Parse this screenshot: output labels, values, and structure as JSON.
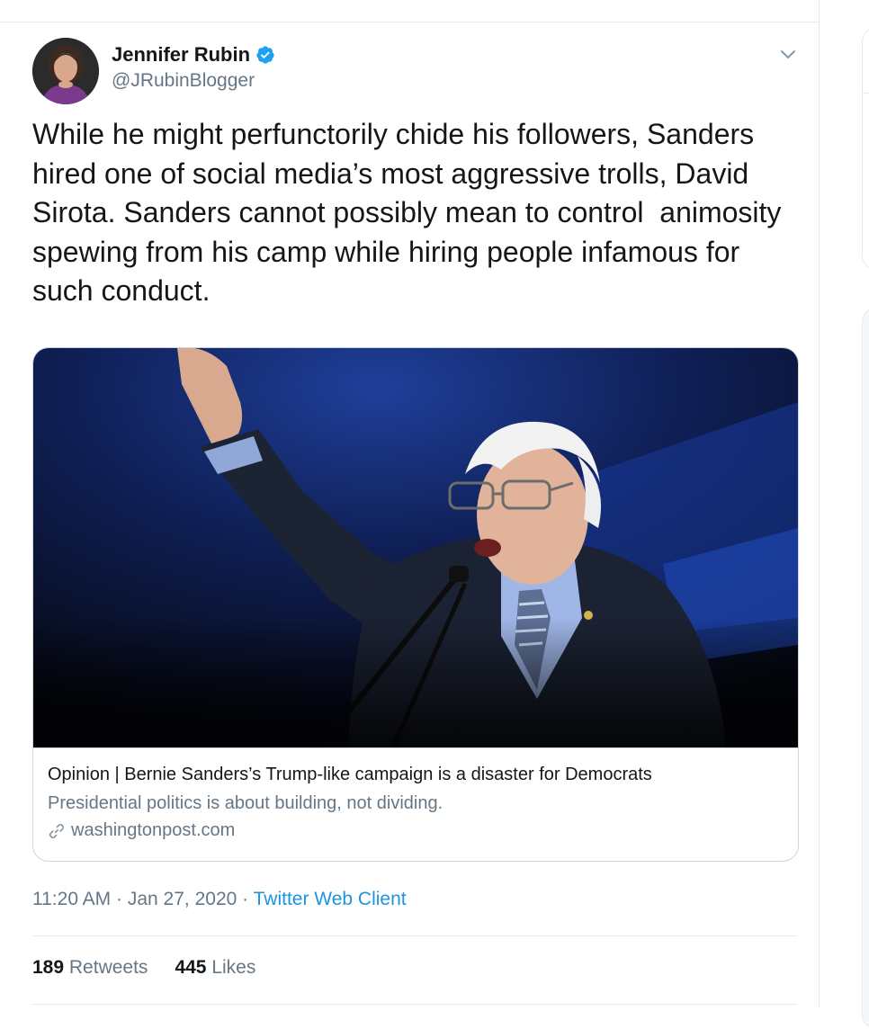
{
  "author": {
    "name": "Jennifer Rubin",
    "handle": "@JRubinBlogger",
    "avatar_icon": "profile-photo",
    "verified_icon": "verified-badge-icon"
  },
  "tweet": {
    "text": "While he might perfunctorily chide his followers, Sanders hired one of social media’s most aggressive trolls, David Sirota. Sanders cannot possibly mean to control  animosity spewing from his camp while hiring people infamous for such conduct."
  },
  "link_card": {
    "title": "Opinion | Bernie Sanders’s Trump-like campaign is a disaster for Democrats",
    "description": "Presidential politics is about building, not dividing.",
    "domain": "washingtonpost.com",
    "image_icon": "photo-of-speaker-at-podium"
  },
  "meta": {
    "time": "11:20 AM",
    "separator": "·",
    "date": "Jan 27, 2020",
    "client": "Twitter Web Client"
  },
  "stats": {
    "retweets_count": "189",
    "retweets_label": "Retweets",
    "likes_count": "445",
    "likes_label": "Likes"
  },
  "colors": {
    "accent": "#1da1f2",
    "link": "#1b95e0",
    "secondary_text": "#657786",
    "border": "#ccd6dd"
  }
}
